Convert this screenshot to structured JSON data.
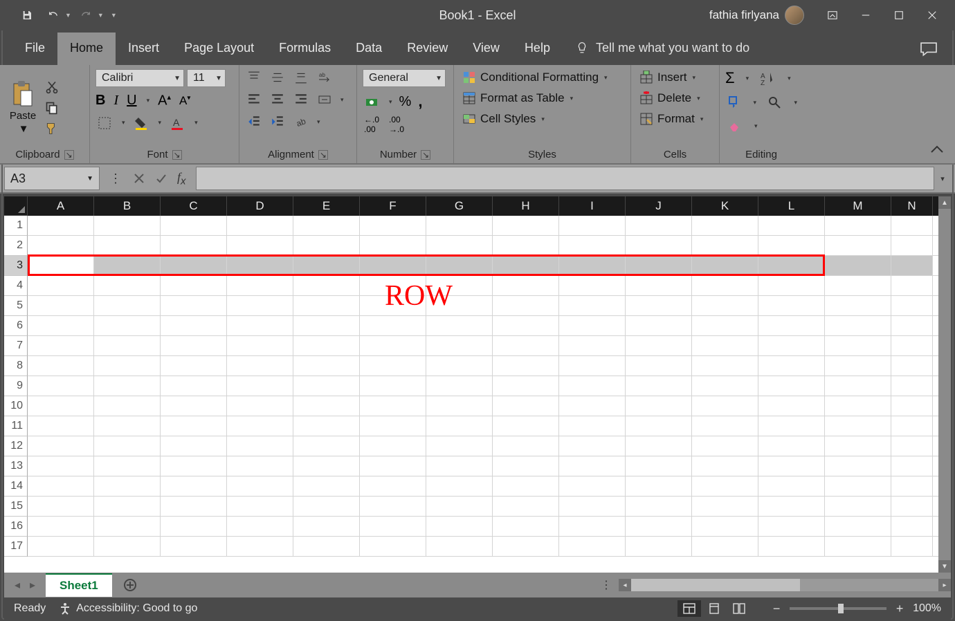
{
  "title": "Book1  -  Excel",
  "user": "fathia firlyana",
  "menu": {
    "file": "File",
    "home": "Home",
    "insert": "Insert",
    "pageLayout": "Page Layout",
    "formulas": "Formulas",
    "data": "Data",
    "review": "Review",
    "view": "View",
    "help": "Help",
    "tellMe": "Tell me what you want to do"
  },
  "ribbon": {
    "clipboard": {
      "paste": "Paste",
      "label": "Clipboard"
    },
    "font": {
      "name": "Calibri",
      "size": "11",
      "label": "Font"
    },
    "alignment": {
      "label": "Alignment"
    },
    "number": {
      "format": "General",
      "label": "Number"
    },
    "styles": {
      "cond": "Conditional Formatting",
      "table": "Format as Table",
      "cell": "Cell Styles",
      "label": "Styles"
    },
    "cells": {
      "insert": "Insert",
      "delete": "Delete",
      "format": "Format",
      "label": "Cells"
    },
    "editing": {
      "label": "Editing"
    }
  },
  "nameBox": "A3",
  "columns": [
    "A",
    "B",
    "C",
    "D",
    "E",
    "F",
    "G",
    "H",
    "I",
    "J",
    "K",
    "L",
    "M",
    "N"
  ],
  "rows": [
    "1",
    "2",
    "3",
    "4",
    "5",
    "6",
    "7",
    "8",
    "9",
    "10",
    "11",
    "12",
    "13",
    "14",
    "15",
    "16",
    "17"
  ],
  "selectedRow": 3,
  "annotation": "ROW",
  "sheet": {
    "name": "Sheet1"
  },
  "status": {
    "ready": "Ready",
    "access": "Accessibility: Good to go",
    "zoom": "100%"
  }
}
